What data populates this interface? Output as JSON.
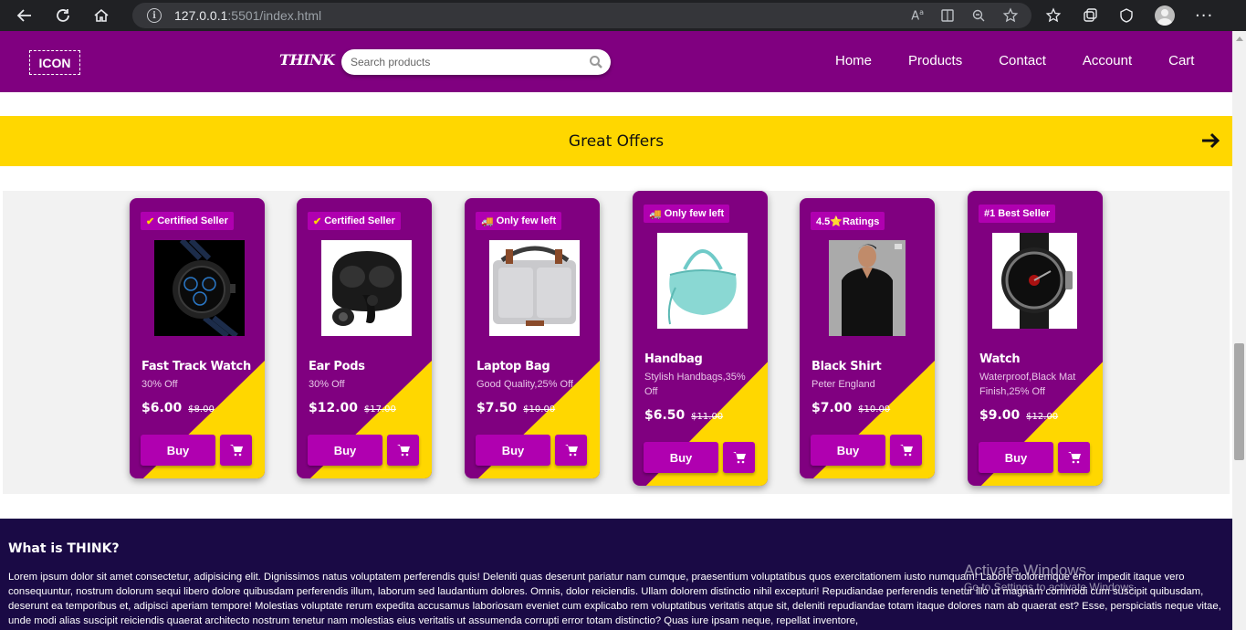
{
  "browser": {
    "url_host": "127.0.0.1",
    "url_path": ":5501/index.html"
  },
  "header": {
    "logo_text": "ICON",
    "brand": "THINK",
    "search_placeholder": "Search products",
    "nav": [
      "Home",
      "Products",
      "Contact",
      "Account",
      "Cart"
    ]
  },
  "offers": {
    "title": "Great Offers"
  },
  "products": [
    {
      "badge": "Certified Seller",
      "badge_icon": "check-icon",
      "name": "Fast Track Watch",
      "desc": "30% Off",
      "price": "$6.00",
      "old_price": "$8.00",
      "buy_label": "Buy"
    },
    {
      "badge": "Certified Seller",
      "badge_icon": "check-icon",
      "name": "Ear Pods",
      "desc": "30% Off",
      "price": "$12.00",
      "old_price": "$17.00",
      "buy_label": "Buy"
    },
    {
      "badge": "Only few left",
      "badge_icon": "truck-icon",
      "name": "Laptop Bag",
      "desc": "Good Quality,25% Off",
      "price": "$7.50",
      "old_price": "$10.00",
      "buy_label": "Buy"
    },
    {
      "badge": "Only few left",
      "badge_icon": "truck-icon",
      "name": "Handbag",
      "desc": "Stylish Handbags,35% Off",
      "price": "$6.50",
      "old_price": "$11.00",
      "buy_label": "Buy"
    },
    {
      "badge": "4.5⭐Ratings",
      "badge_icon": "star-icon",
      "name": "Black Shirt",
      "desc": "Peter England",
      "price": "$7.00",
      "old_price": "$10.00",
      "buy_label": "Buy"
    },
    {
      "badge": "#1 Best Seller",
      "badge_icon": "",
      "name": "Watch",
      "desc": "Waterproof,Black Mat Finish,25% Off",
      "price": "$9.00",
      "old_price": "$12.00",
      "buy_label": "Buy"
    }
  ],
  "about": {
    "title": "What is THINK?",
    "text": "Lorem ipsum dolor sit amet consectetur, adipisicing elit. Dignissimos natus voluptatem perferendis quis! Deleniti quas deserunt pariatur nam cumque, praesentium voluptatibus quos exercitationem iusto numquam! Labore doloremque error impedit itaque vero consequuntur, nostrum dolorum sequi libero dolore quibusdam perferendis illum, laborum sed laudantium dolores. Omnis, dolor reiciendis. Ullam dolorem distinctio nihil excepturi! Repudiandae perferendis tenetur illo ut magnam commodi cum suscipit quibusdam, deserunt ea temporibus et, adipisci aperiam tempore! Molestias voluptate rerum expedita accusamus laboriosam eveniet cum explicabo rem voluptatibus veritatis atque sit, deleniti repudiandae totam itaque dolores nam ab quaerat est? Esse, perspiciatis neque vitae, unde modi alias suscipit reiciendis quaerat architecto nostrum tenetur nam molestias eius veritatis ut assumenda corrupti error totam distinctio? Quas iure ipsam neque, repellat inventore,"
  },
  "watermark": {
    "line1": "Activate Windows",
    "line2": "Go to Settings to activate Windows."
  },
  "colors": {
    "primary": "#800080",
    "accent": "#ffd700",
    "button": "#b000b0",
    "footer": "#1a0a45"
  }
}
